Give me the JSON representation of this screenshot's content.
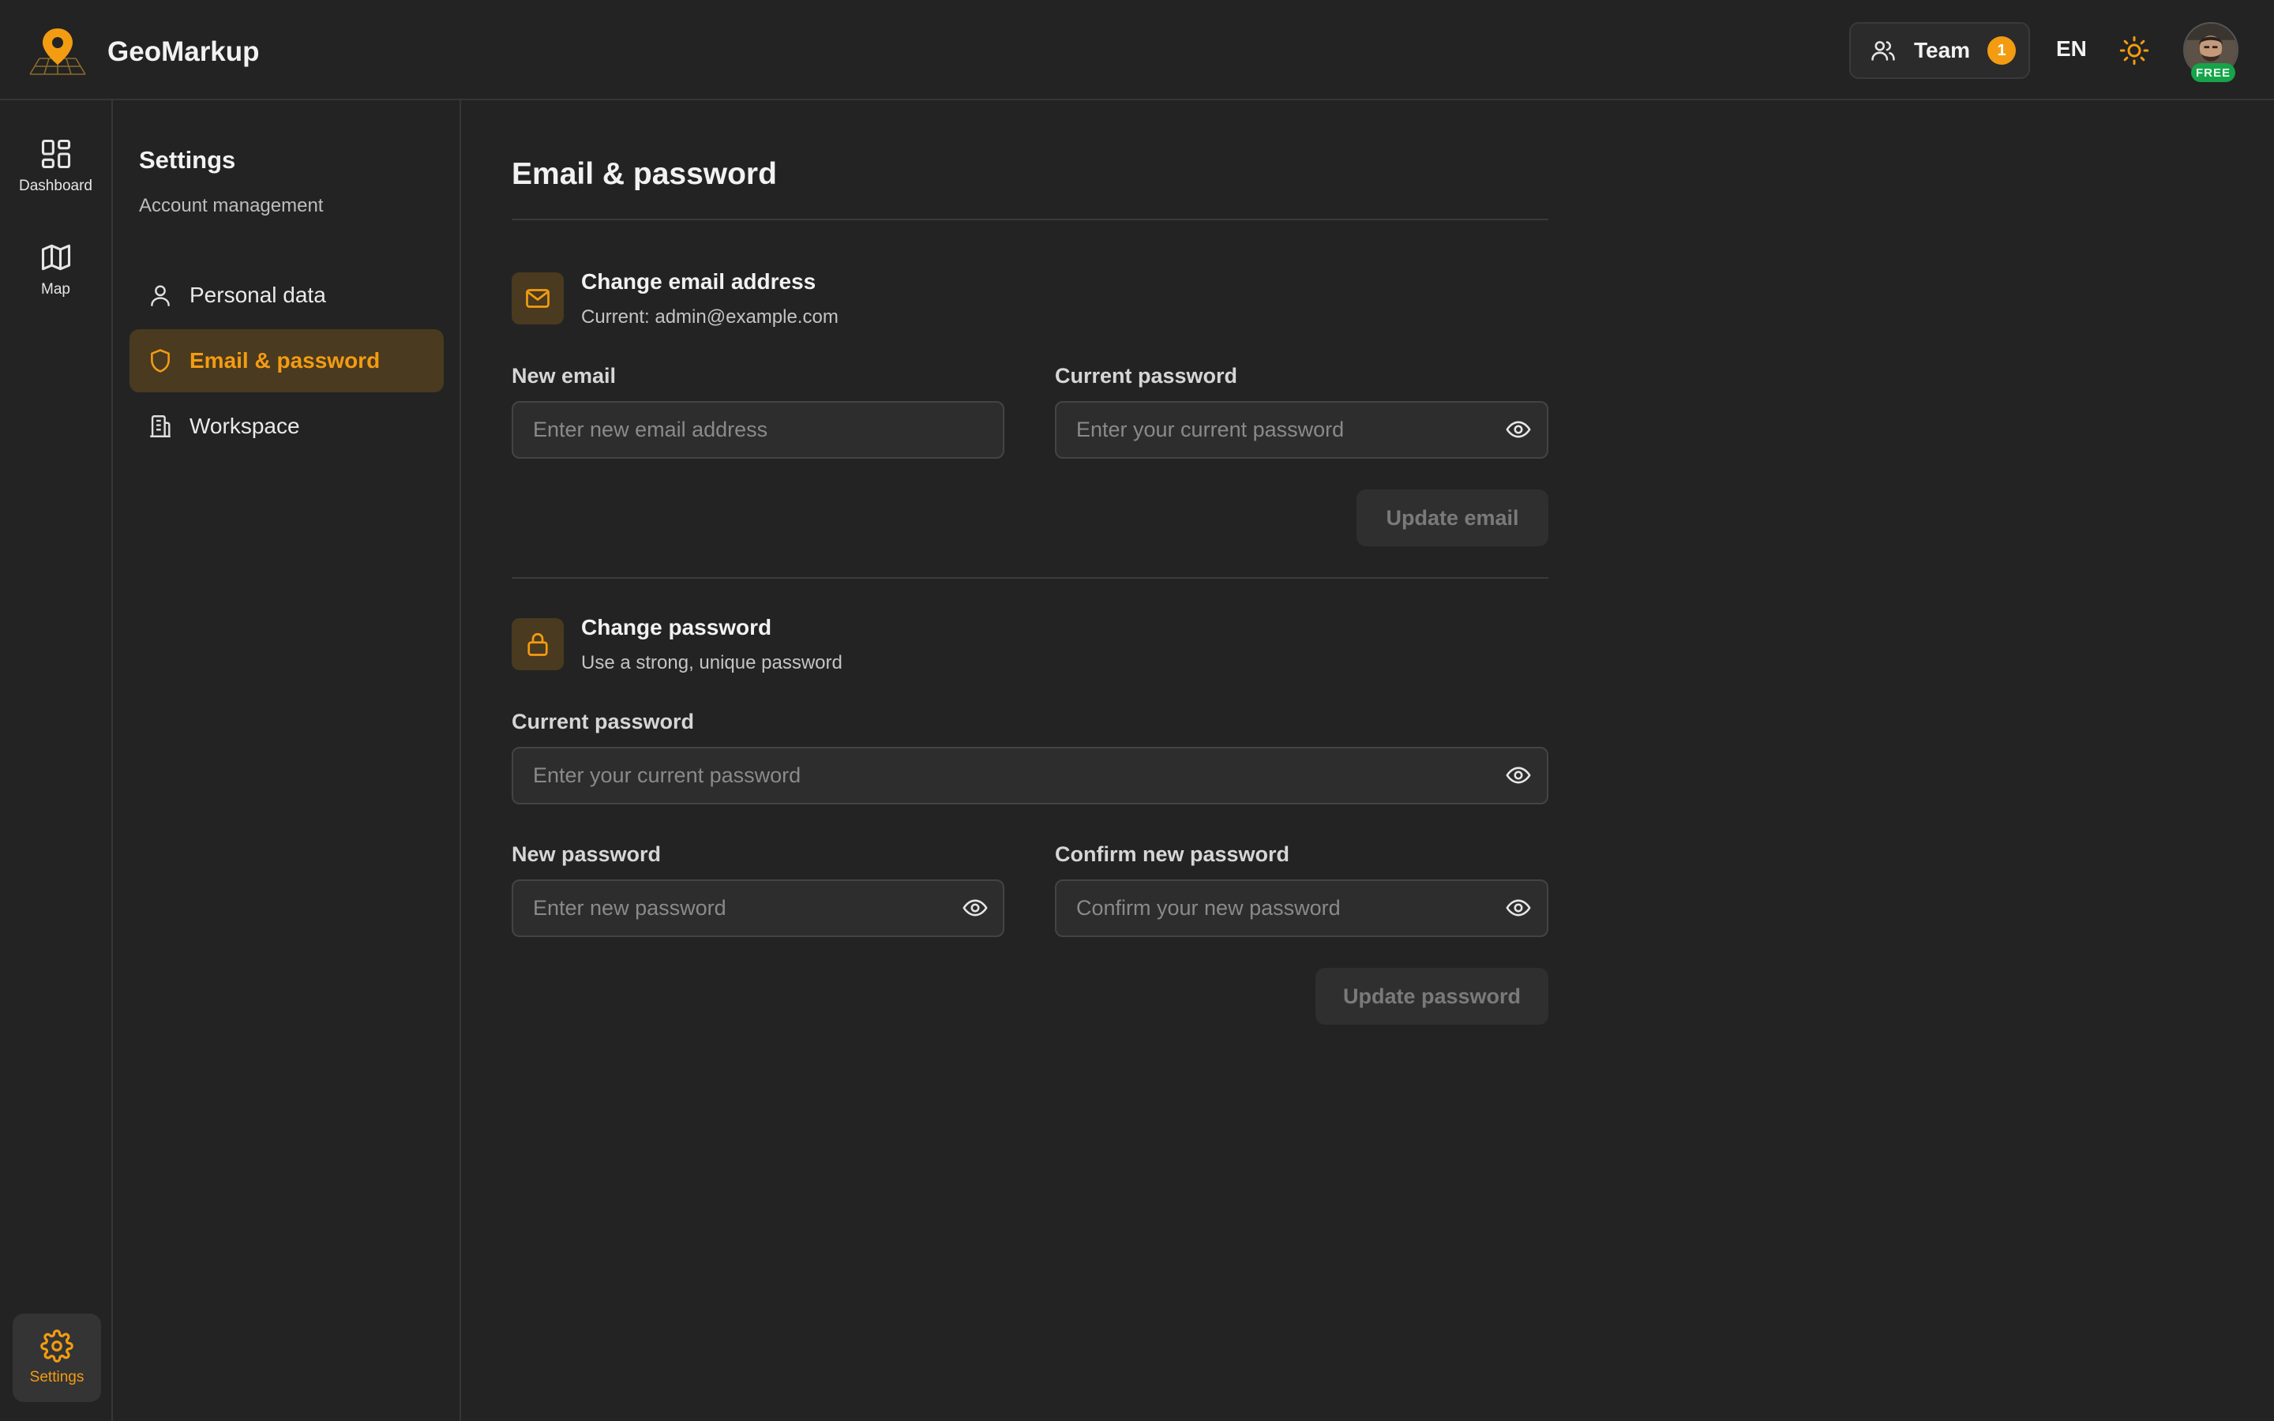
{
  "app": {
    "name": "GeoMarkup",
    "accent_color": "#f39c12",
    "background": "#232323"
  },
  "header": {
    "team_label": "Team",
    "team_count": "1",
    "language": "EN",
    "theme_icon": "sun-icon",
    "plan_badge": "FREE"
  },
  "rail": {
    "items": [
      {
        "label": "Dashboard",
        "icon": "dashboard-grid-icon"
      },
      {
        "label": "Map",
        "icon": "map-icon"
      }
    ],
    "settings": {
      "label": "Settings",
      "icon": "gear-icon"
    }
  },
  "sidebar": {
    "title": "Settings",
    "subtitle": "Account management",
    "items": [
      {
        "label": "Personal data",
        "icon": "user-icon",
        "active": false
      },
      {
        "label": "Email & password",
        "icon": "shield-icon",
        "active": true
      },
      {
        "label": "Workspace",
        "icon": "building-icon",
        "active": false
      }
    ]
  },
  "main": {
    "page_title": "Email & password",
    "email_section": {
      "title": "Change email address",
      "subtitle": "Current: admin@example.com",
      "new_email_label": "New email",
      "new_email_placeholder": "Enter new email address",
      "current_password_label": "Current password",
      "current_password_placeholder": "Enter your current password",
      "submit_label": "Update email"
    },
    "password_section": {
      "title": "Change password",
      "subtitle": "Use a strong, unique password",
      "current_password_label": "Current password",
      "current_password_placeholder": "Enter your current password",
      "new_password_label": "New password",
      "new_password_placeholder": "Enter new password",
      "confirm_password_label": "Confirm new password",
      "confirm_password_placeholder": "Confirm your new password",
      "submit_label": "Update password"
    }
  }
}
